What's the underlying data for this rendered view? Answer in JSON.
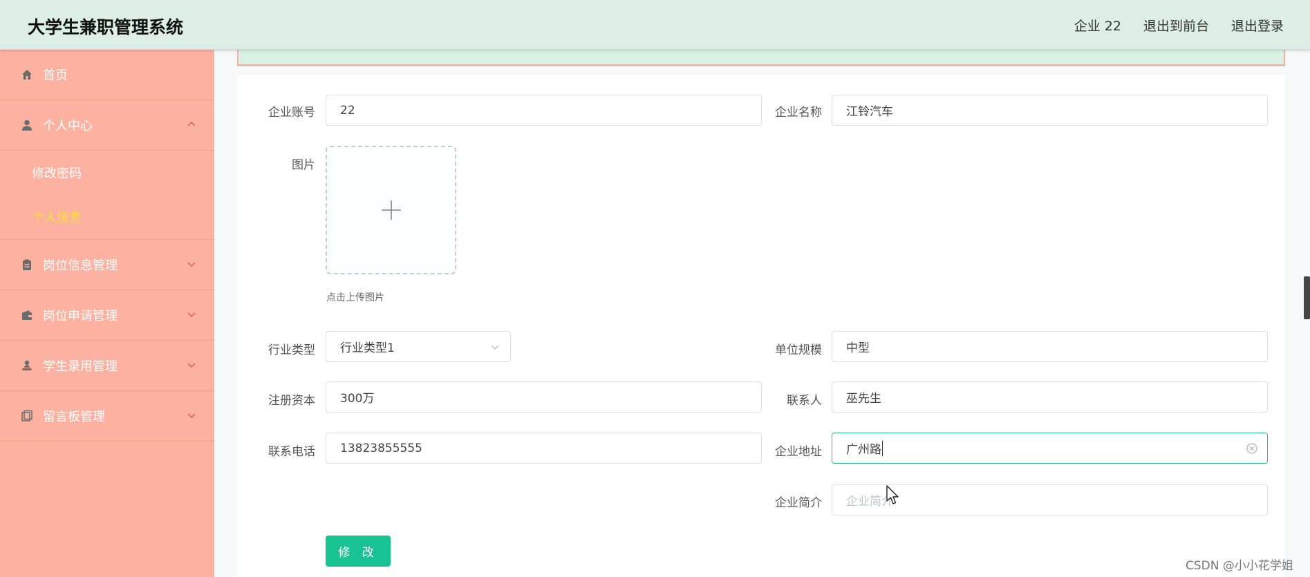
{
  "app": {
    "title": "大学生兼职管理系统"
  },
  "header": {
    "user_label": "企业 22",
    "front_link": "退出到前台",
    "logout_link": "退出登录"
  },
  "sidebar": {
    "home": "首页",
    "personal_center": "个人中心",
    "change_password": "修改密码",
    "personal_info": "个人信息",
    "job_info_mgmt": "岗位信息管理",
    "job_apply_mgmt": "岗位申请管理",
    "student_hire_mgmt": "学生录用管理",
    "message_board_mgmt": "留言板管理"
  },
  "form": {
    "account": {
      "label": "企业账号",
      "value": "22"
    },
    "company_name": {
      "label": "企业名称",
      "value": "江铃汽车"
    },
    "image": {
      "label": "图片",
      "hint": "点击上传图片"
    },
    "industry": {
      "label": "行业类型",
      "value": "行业类型1"
    },
    "scale": {
      "label": "单位规模",
      "value": "中型"
    },
    "capital": {
      "label": "注册资本",
      "value": "300万"
    },
    "contact": {
      "label": "联系人",
      "value": "巫先生"
    },
    "phone": {
      "label": "联系电话",
      "value": "13823855555"
    },
    "address": {
      "label": "企业地址",
      "value": "广州路"
    },
    "intro": {
      "label": "企业简介",
      "placeholder": "企业简介"
    },
    "submit": "修 改"
  },
  "watermark": "CSDN @小小花学姐",
  "colors": {
    "header_bg": "#ddeee6",
    "sidebar_bg": "#fdb1a1",
    "active_submenu": "#f7e22d",
    "primary_button": "#19c293",
    "focus_border": "#2bb98f"
  }
}
